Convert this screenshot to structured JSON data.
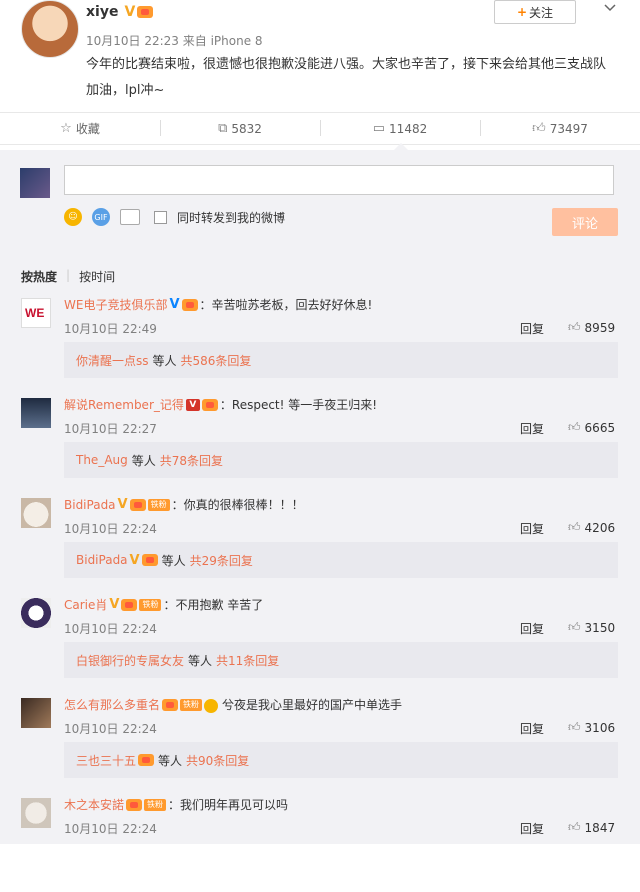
{
  "post": {
    "username": "xiye",
    "meta": "10月10日 22:23 来自 iPhone 8",
    "text": "今年的比赛结束啦，很遗憾也很抱歉没能进八强。大家也辛苦了，接下来会给其他三支战队加油，lpl冲~",
    "follow_label": "关注",
    "follow_plus": "+"
  },
  "actions": [
    {
      "label": "收藏",
      "icon": "star-icon"
    },
    {
      "label": "5832",
      "icon": "repost-icon"
    },
    {
      "label": "11482",
      "icon": "comment-icon"
    },
    {
      "label": "73497",
      "icon": "like-icon"
    }
  ],
  "composer": {
    "checkbox_label": "同时转发到我的微博",
    "submit_label": "评论"
  },
  "sort": {
    "hot": "按热度",
    "time": "按时间"
  },
  "comments": [
    {
      "name": "WE电子竞技俱乐部",
      "text": "：辛苦啦苏老板，回去好好休息!",
      "time": "10月10日 22:49",
      "reply": "回复",
      "likes": "8959",
      "sub_user": "你清醒一点ss",
      "sub_mid": "等人",
      "sub_link": "共586条回复"
    },
    {
      "name": "解说Remember_记得",
      "text": "：Respect!  等一手夜王归来!",
      "time": "10月10日 22:27",
      "reply": "回复",
      "likes": "6665",
      "sub_user": "The_Aug",
      "sub_mid": "等人",
      "sub_link": "共78条回复"
    },
    {
      "name": "BidiPada",
      "text": "：你真的很棒很棒！！！",
      "time": "10月10日 22:24",
      "reply": "回复",
      "likes": "4206",
      "sub_user": "BidiPada",
      "sub_mid": "等人",
      "sub_link": "共29条回复",
      "fan_badge": "铁粉"
    },
    {
      "name": "Carie肖",
      "text": "：不用抱歉 辛苦了",
      "time": "10月10日 22:24",
      "reply": "回复",
      "likes": "3150",
      "sub_user": "白银御行的专属女友",
      "sub_mid": "等人",
      "sub_link": "共11条回复",
      "fan_badge": "铁粉"
    },
    {
      "name": "怎么有那么多重名",
      "text": "兮夜是我心里最好的国产中单选手",
      "time": "10月10日 22:24",
      "reply": "回复",
      "likes": "3106",
      "sub_user": "三也三十五",
      "sub_mid": "等人",
      "sub_link": "共90条回复",
      "fan_badge": "铁粉"
    },
    {
      "name": "木之本安諾",
      "text": "：我们明年再见可以吗",
      "time": "10月10日 22:24",
      "reply": "回复",
      "likes": "1847",
      "fan_badge": "铁粉"
    }
  ],
  "colors": {
    "accent": "#eb7350",
    "follow_plus": "#ff8200",
    "submit_bg": "#ffc09f",
    "panel_bg": "#f2f2f5",
    "subbox_bg": "#e9e9ee"
  }
}
